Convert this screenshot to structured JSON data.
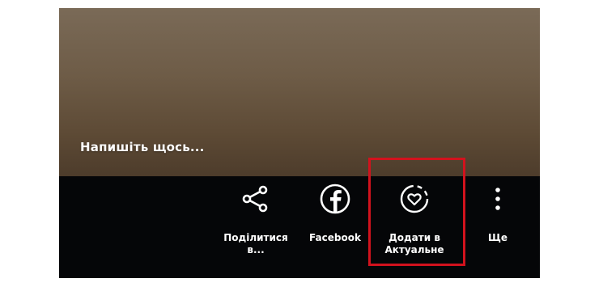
{
  "story": {
    "caption_placeholder": "Напишіть щось..."
  },
  "actions": [
    {
      "label": "Поділитися\nв...",
      "icon": "share-icon"
    },
    {
      "label": "Facebook",
      "icon": "facebook-icon"
    },
    {
      "label": "Додати в\nАктуальне",
      "icon": "highlight-heart-icon"
    },
    {
      "label": "Ще",
      "icon": "more-vertical-icon"
    }
  ],
  "colors": {
    "background": "#050608",
    "preview_top": "#7a6a57",
    "preview_bottom": "#4d3c2b",
    "text": "#ffffff",
    "annotation_box": "#d2121d"
  }
}
